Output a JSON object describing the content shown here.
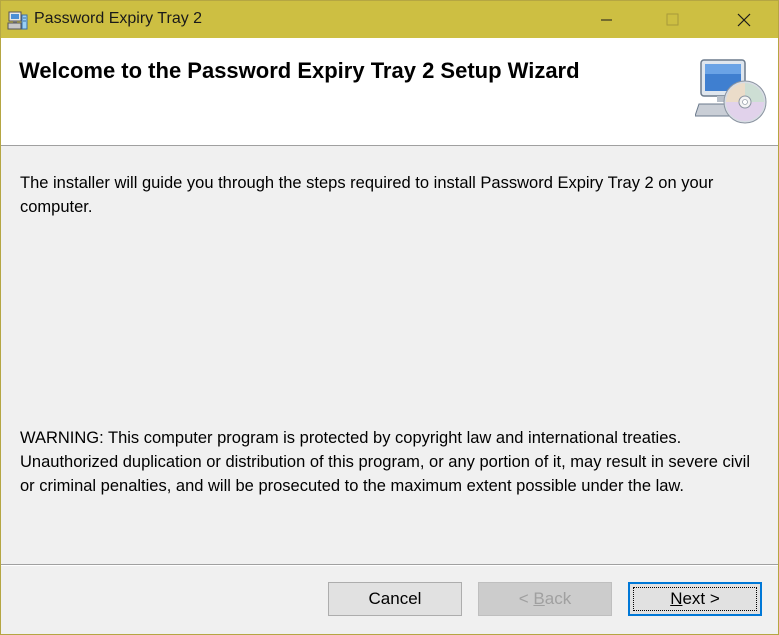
{
  "window": {
    "title": "Password Expiry Tray 2"
  },
  "header": {
    "title": "Welcome to the Password Expiry Tray 2 Setup Wizard",
    "graphic_icon": "computer-cd-icon"
  },
  "body": {
    "intro": "The installer will guide you through the steps required to install Password Expiry Tray 2 on your computer.",
    "warning": "WARNING: This computer program is protected by copyright law and international treaties. Unauthorized duplication or distribution of this program, or any portion of it, may result in severe civil or criminal penalties, and will be prosecuted to the maximum extent possible under the law."
  },
  "buttons": {
    "cancel": "Cancel",
    "back_prefix": "< ",
    "back_mnemonic": "B",
    "back_rest": "ack",
    "next_mnemonic": "N",
    "next_rest": "ext >"
  },
  "colors": {
    "titlebar": "#cdbf42",
    "focus_border": "#0078d7"
  }
}
